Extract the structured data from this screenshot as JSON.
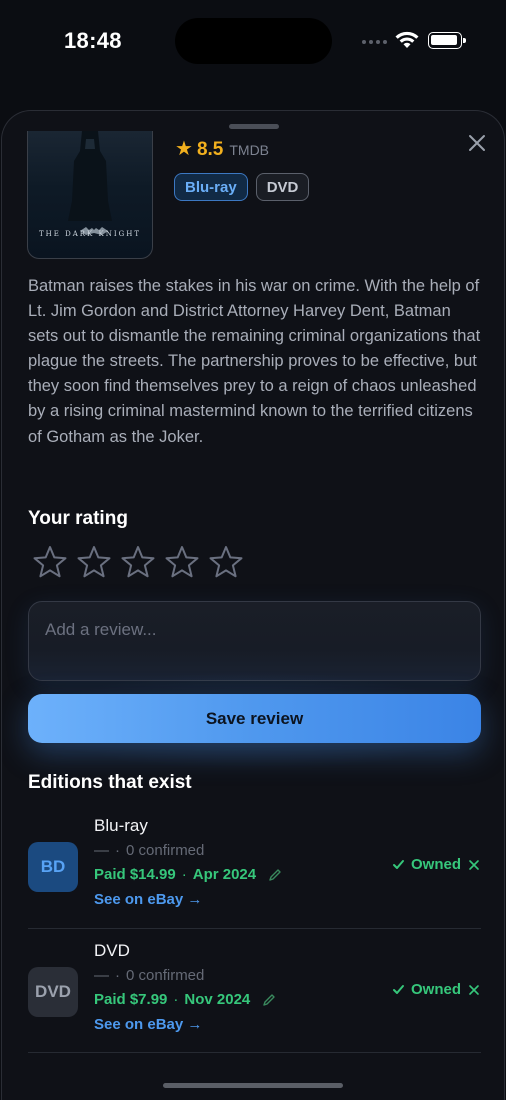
{
  "status_bar": {
    "time": "18:48"
  },
  "movie": {
    "poster_title": "THE DARK KNIGHT",
    "tmdb_score": "8.5",
    "tmdb_label": "TMDB",
    "formats": [
      "Blu-ray",
      "DVD"
    ],
    "overview": "Batman raises the stakes in his war on crime. With the help of Lt. Jim Gordon and District Attorney Harvey Dent, Batman sets out to dismantle the remaining criminal organizations that plague the streets. The partnership proves to be effective, but they soon find themselves prey to a reign of chaos unleashed by a rising criminal mastermind known to the terrified citizens of Gotham as the Joker."
  },
  "your_rating": {
    "title": "Your rating",
    "stars_filled": 0,
    "stars_total": 5,
    "review_placeholder": "Add a review...",
    "save_label": "Save review"
  },
  "editions": {
    "title": "Editions that exist",
    "items": [
      {
        "badge": "BD",
        "name": "Blu-ray",
        "dash": "—",
        "confirmed": "0 confirmed",
        "paid": "Paid $14.99",
        "date": "Apr 2024",
        "ebay": "See on eBay →",
        "owned": "Owned"
      },
      {
        "badge": "DVD",
        "name": "DVD",
        "dash": "—",
        "confirmed": "0 confirmed",
        "paid": "Paid $7.99",
        "date": "Nov 2024",
        "ebay": "See on eBay →",
        "owned": "Owned"
      }
    ]
  },
  "colors": {
    "accent_blue": "#4d99ee",
    "owned_green": "#36c77b",
    "tmdb_gold": "#f2b01e"
  }
}
